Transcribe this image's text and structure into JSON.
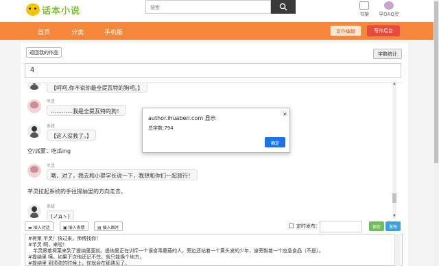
{
  "header": {
    "logo_text": "话本小说",
    "search_placeholder": "搜索",
    "bookshelf_label": "书架",
    "qq_label": "孚QAQ灵"
  },
  "nav": {
    "items": [
      {
        "label": "首页"
      },
      {
        "label": "分类"
      },
      {
        "label": "手机版"
      }
    ],
    "codex_button": "写作编辑",
    "backend_button": "写作后台"
  },
  "main": {
    "back_button": "返回我的作品",
    "word_count_button": "字数统计",
    "chapter_title": "4"
  },
  "chat": {
    "messages": [
      {
        "type": "bubble",
        "avatar": "system",
        "speaker": "",
        "text": "【呵呵,你不说你最全提瓦特的狗吧。】"
      },
      {
        "type": "bubble",
        "avatar": "girl",
        "speaker": "芊灵",
        "text": "…………我是全提瓦特的狗！"
      },
      {
        "type": "bubble",
        "avatar": "system",
        "speaker": "系统",
        "text": "【这人没救了。】"
      },
      {
        "type": "narration",
        "text": "空/派蒙：吃瓜ing"
      },
      {
        "type": "bubble",
        "avatar": "girl",
        "speaker": "芊灵",
        "text": "哦，对了，我去和小提学长说一下，我想和你们一起旅行！"
      },
      {
        "type": "narration",
        "text": "芊灵拉起系统的手往提纳里的方向走去。"
      },
      {
        "type": "bubble",
        "avatar": "system",
        "speaker": "系统",
        "text": "(ノдヽ)"
      }
    ]
  },
  "toolbar": {
    "insert_dialog": "插入对话",
    "insert_emoji": "插入表情",
    "insert_image": "插入图片",
    "timed_publish_label": "定时发布：",
    "timed_publish_value": "",
    "save_button": "保存",
    "publish_button": "发布"
  },
  "editor": {
    "lines": [
      "#柯莱 芊灵！快过来，师傅找你！",
      "#芊灵 啊，来啦！",
      "　芊灵跟着柯莱来到了提纳里面前。提纳里正在训斥一个误食毒蘑菇的人，旁边还站着一个黄头发的少年，身旁飘着一个应急食品（不是）。",
      "#提纳里 咦，如果下次他还记不住，就只能换个地方，",
      "#提纳里 到须弥的时候上，你就会在那遇见了。"
    ]
  },
  "dialog": {
    "title": "author.ihuaben.com 显示",
    "message": "总字数:794",
    "ok_button": "确定",
    "close_symbol": "×"
  },
  "colors": {
    "nav_orange": "#f5873b",
    "backend_red": "#e84b3d",
    "save_green": "#6cbf5a",
    "publish_blue": "#3da2dc",
    "dialog_ok_blue": "#1a73e8"
  }
}
